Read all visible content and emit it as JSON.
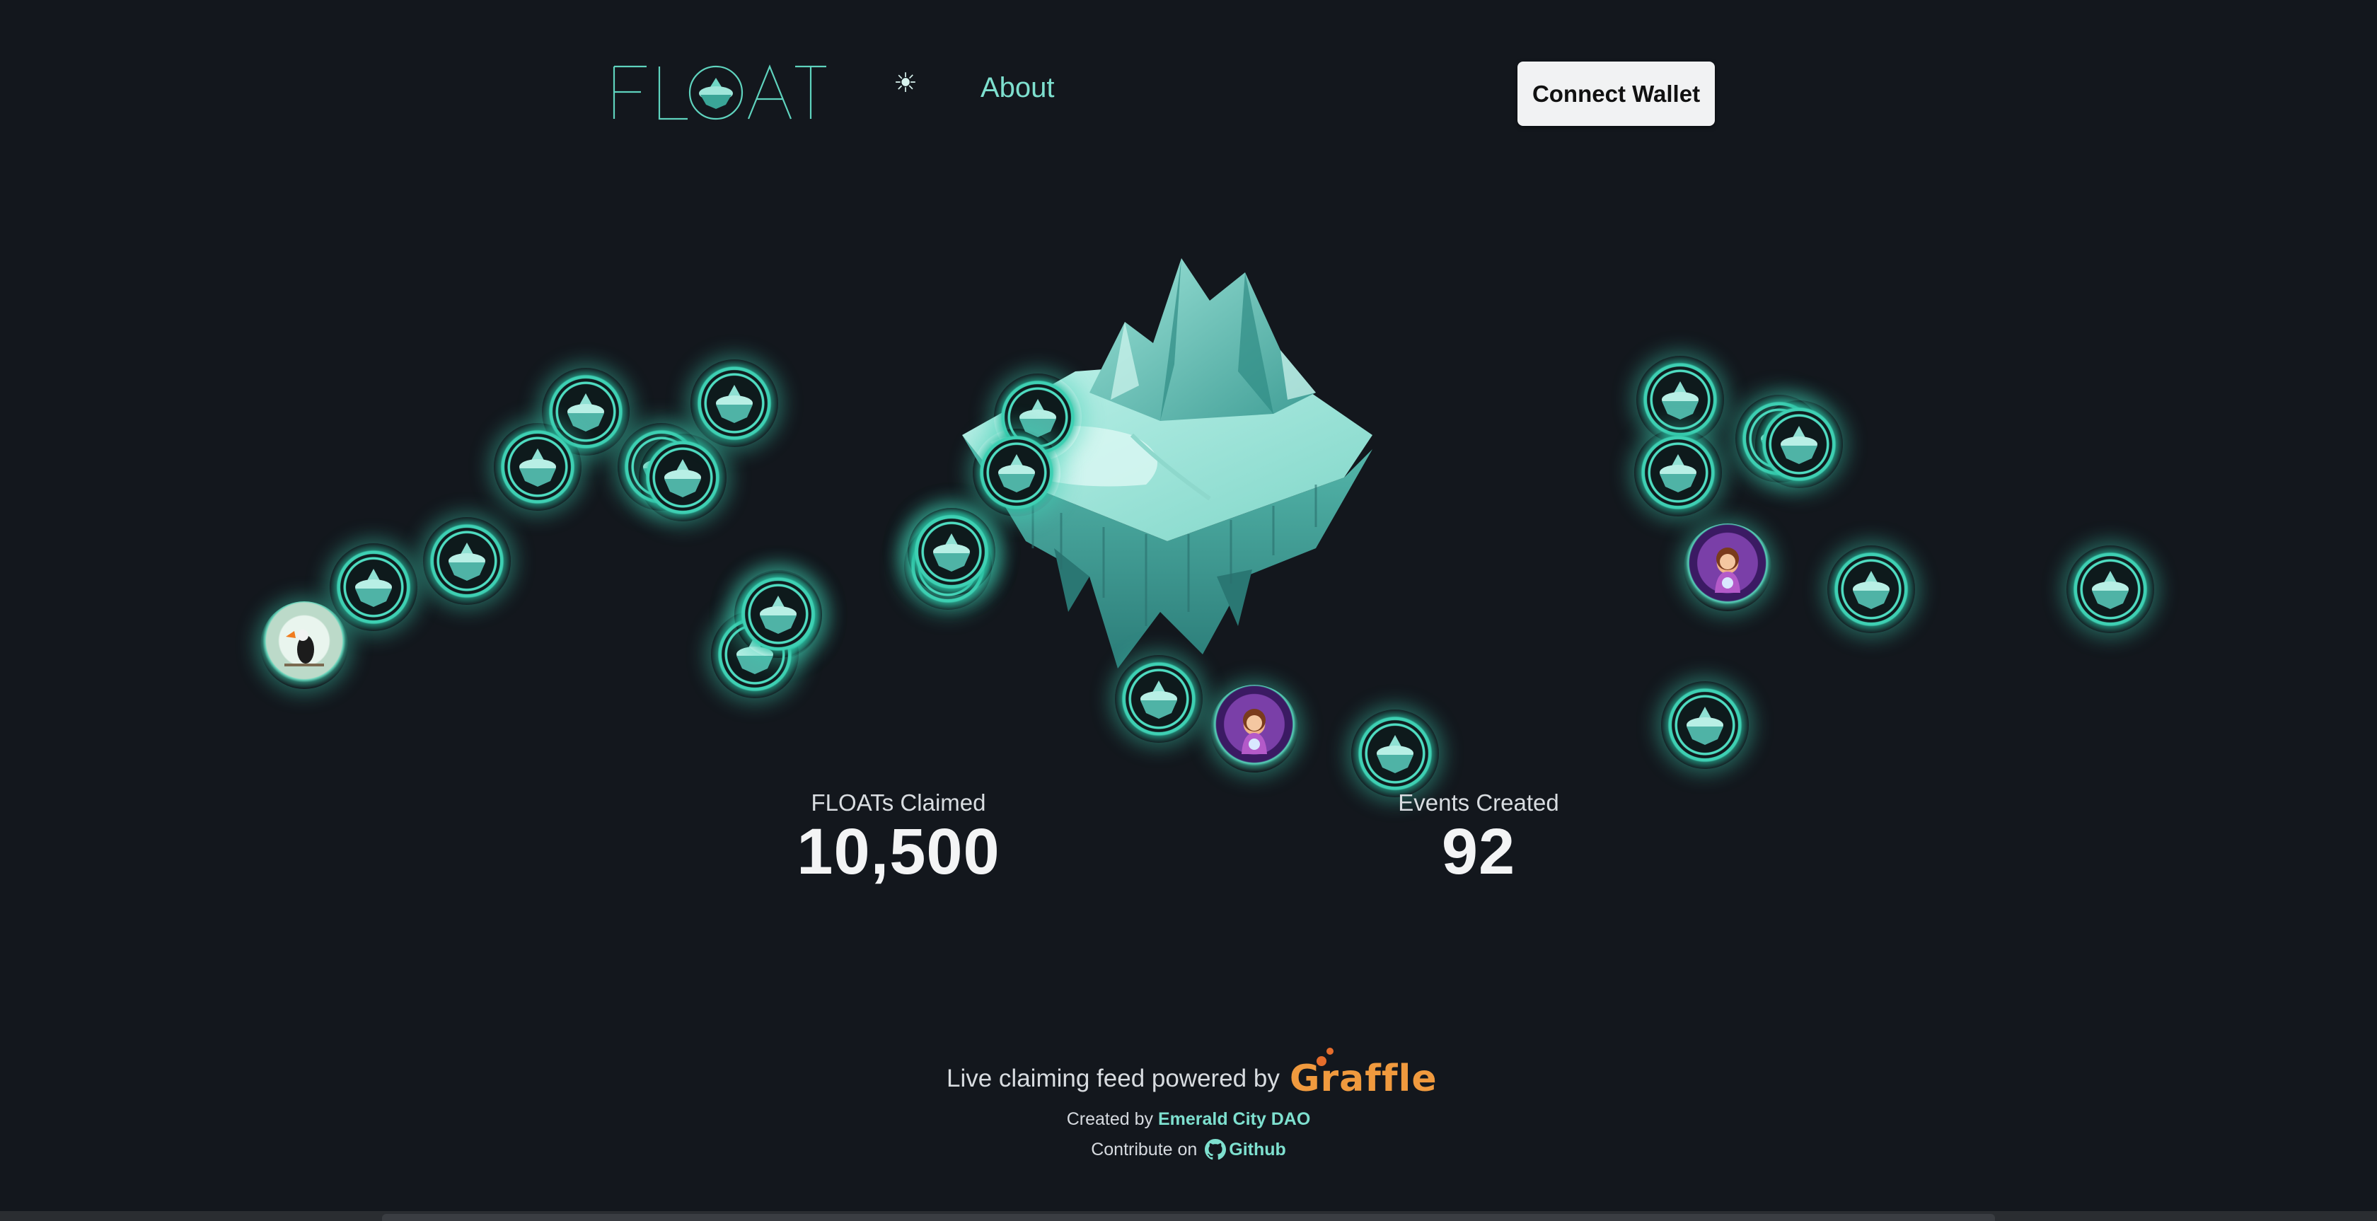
{
  "header": {
    "logo_text": "FLOAT",
    "theme_toggle_glyph": "☀",
    "about_label": "About",
    "connect_label": "Connect Wallet"
  },
  "stats": {
    "claimed_label": "FLOATs Claimed",
    "claimed_value": "10,500",
    "events_label": "Events Created",
    "events_value": "92"
  },
  "footer": {
    "powered_text": "Live claiming feed powered by",
    "graffle_logo_text": "Graffle",
    "created_prefix": "Created by",
    "created_link": "Emerald City DAO",
    "contribute_prefix": "Contribute on",
    "contribute_link": "Github",
    "github_icon": "github-icon"
  },
  "colors": {
    "background": "#13171d",
    "accent": "#7ee0cf",
    "badge_glow": "#3ed0b3",
    "graffle_orange": "#f09a3e"
  },
  "floating_badges": [
    {
      "kind": "island"
    },
    {
      "kind": "island"
    },
    {
      "kind": "island"
    },
    {
      "kind": "island"
    },
    {
      "kind": "island"
    },
    {
      "kind": "island"
    },
    {
      "kind": "island"
    },
    {
      "kind": "island"
    },
    {
      "kind": "island"
    },
    {
      "kind": "island"
    },
    {
      "kind": "island"
    },
    {
      "kind": "island"
    },
    {
      "kind": "island"
    },
    {
      "kind": "island"
    },
    {
      "kind": "island"
    },
    {
      "kind": "island"
    },
    {
      "kind": "island"
    },
    {
      "kind": "island"
    },
    {
      "kind": "island"
    },
    {
      "kind": "island"
    },
    {
      "kind": "island"
    },
    {
      "kind": "island"
    },
    {
      "kind": "island"
    },
    {
      "kind": "island"
    },
    {
      "kind": "toucan-photo"
    },
    {
      "kind": "girl-avatar"
    },
    {
      "kind": "purple-avatar"
    }
  ]
}
